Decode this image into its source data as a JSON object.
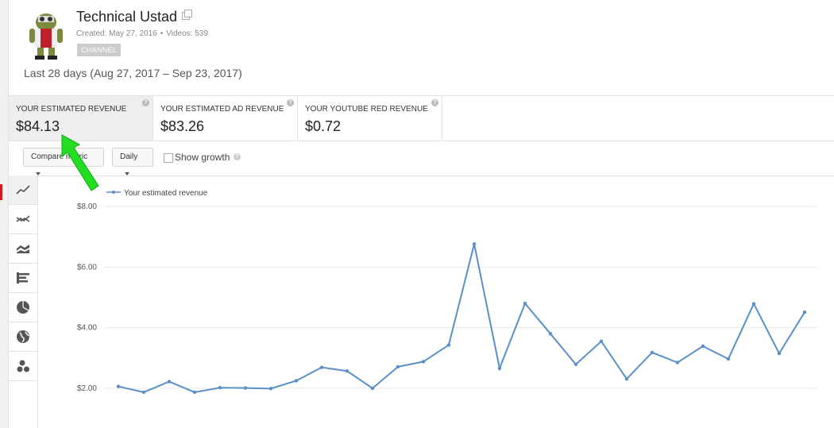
{
  "channel": {
    "title": "Technical Ustad",
    "created": "Created: May 27, 2016",
    "videos": "Videos: 539",
    "badge": "CHANNEL"
  },
  "date_range": "Last 28 days (Aug 27, 2017 – Sep 23, 2017)",
  "metrics": [
    {
      "label": "YOUR ESTIMATED REVENUE",
      "value": "$84.13"
    },
    {
      "label": "YOUR ESTIMATED AD REVENUE",
      "value": "$83.26"
    },
    {
      "label": "YOUR YOUTUBE RED REVENUE",
      "value": "$0.72"
    }
  ],
  "controls": {
    "compare_label": "Compare metric",
    "interval_label": "Daily",
    "growth_label": "Show growth"
  },
  "chart_type_icons": [
    "line-chart-icon",
    "multi-line-chart-icon",
    "stacked-area-chart-icon",
    "bar-chart-icon",
    "pie-chart-icon",
    "globe-icon",
    "bubble-chart-icon"
  ],
  "colors": {
    "series": "#5b8fc7",
    "grid": "#e8e8e8",
    "arrow": "#22dd22"
  },
  "chart_data": {
    "type": "line",
    "legend": [
      "Your estimated revenue"
    ],
    "ylim": [
      1.7,
      8.4
    ],
    "y_ticks": [
      "$8.00",
      "$6.00",
      "$4.00",
      "$2.00"
    ],
    "series": [
      {
        "name": "Your estimated revenue",
        "values": [
          2.06,
          1.87,
          2.22,
          1.87,
          2.02,
          2.01,
          1.99,
          2.25,
          2.69,
          2.57,
          2.0,
          2.71,
          2.88,
          3.43,
          6.76,
          2.66,
          4.8,
          3.8,
          2.79,
          3.55,
          2.31,
          3.18,
          2.85,
          3.39,
          2.97,
          4.79,
          3.15,
          4.51
        ]
      }
    ]
  }
}
